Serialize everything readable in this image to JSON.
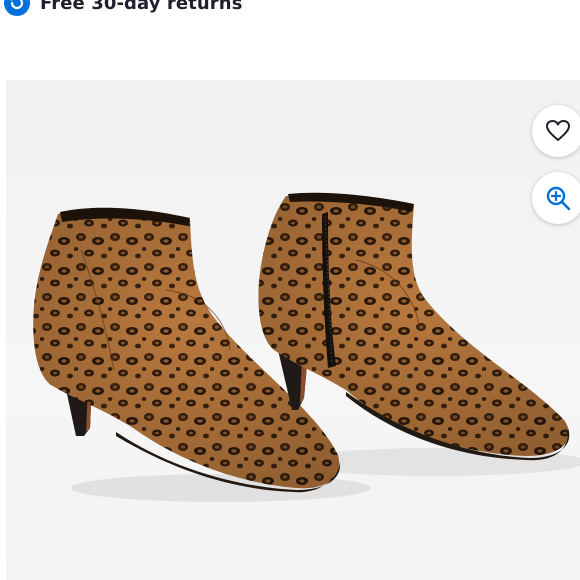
{
  "banner": {
    "text": "Free 30-day returns",
    "icon": "returns-icon"
  },
  "product": {
    "image_alt": "Leopard print suede kitten heel ankle boots",
    "image_icon": "leopard-boots-image"
  },
  "actions": {
    "favorite_icon": "heart-icon",
    "zoom_icon": "zoom-in-icon"
  },
  "colors": {
    "accent": "#0071dc",
    "banner_text": "#1f1f2e",
    "image_bg": "#f3f3f3"
  }
}
